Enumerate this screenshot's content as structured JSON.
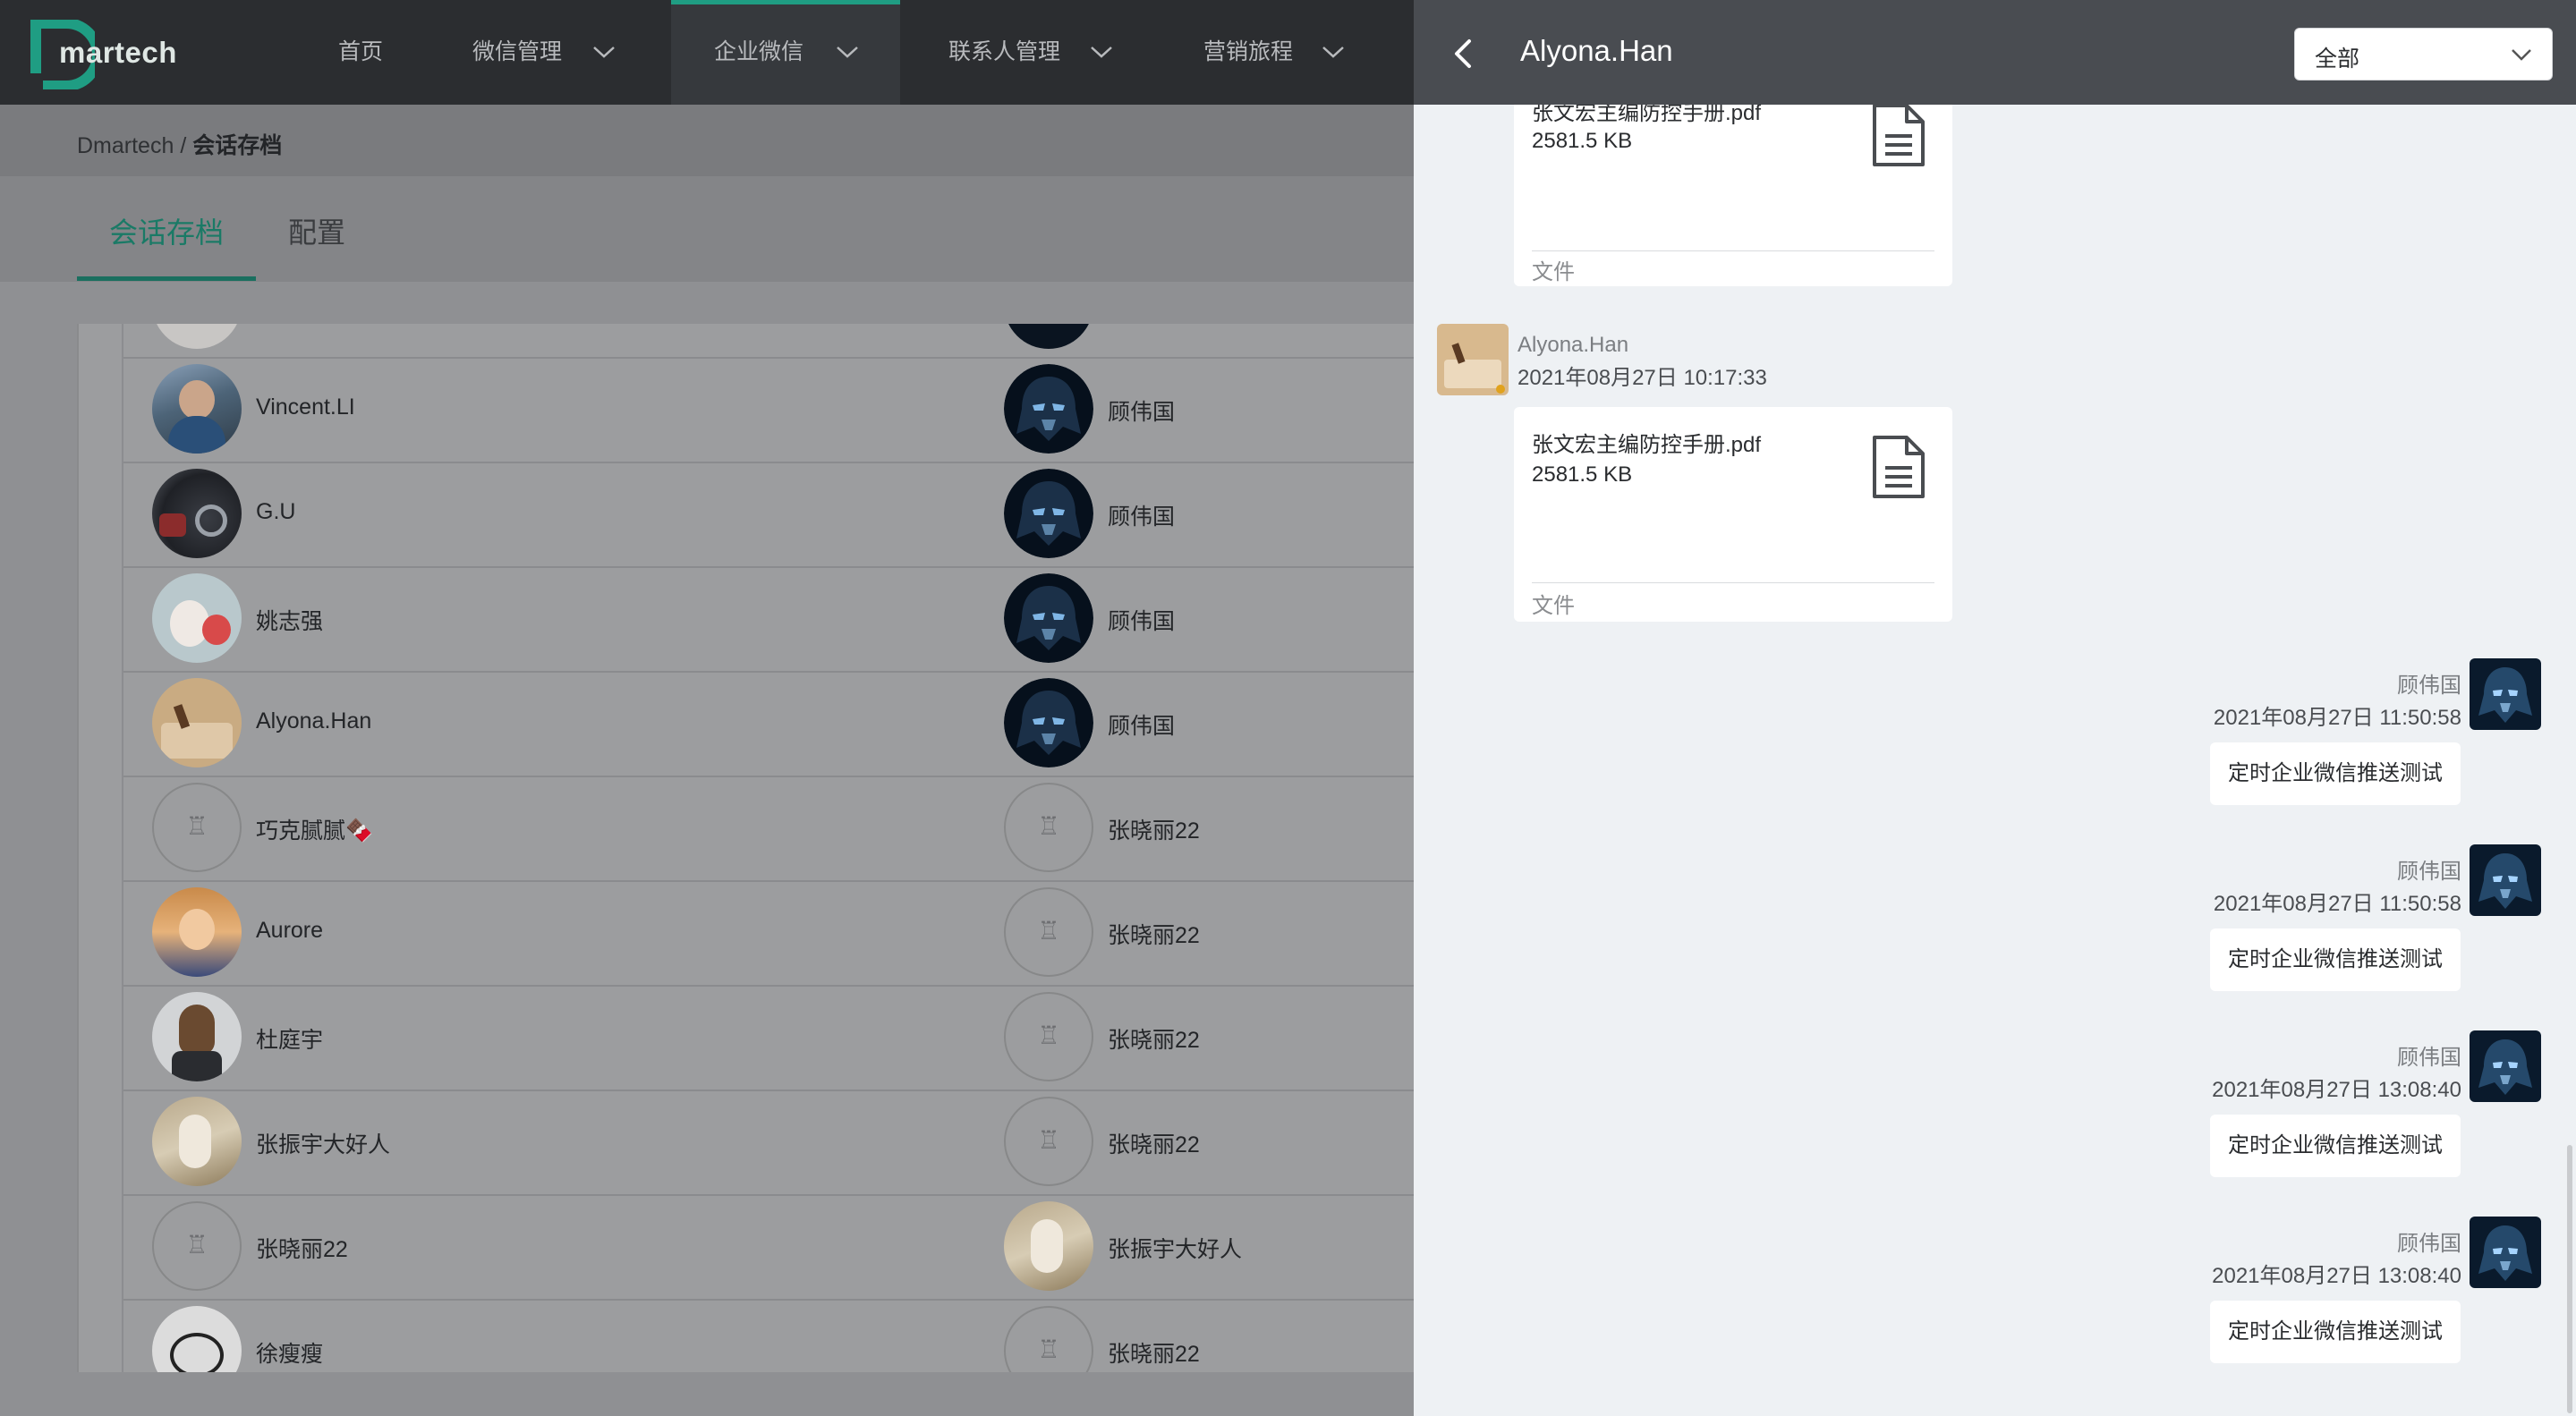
{
  "nav": {
    "logo_text": "martech",
    "items": [
      {
        "label": "首页"
      },
      {
        "label": "微信管理"
      },
      {
        "label": "企业微信"
      },
      {
        "label": "联系人管理"
      },
      {
        "label": "营销旅程"
      }
    ]
  },
  "breadcrumb": {
    "root": "Dmartech",
    "sep": " / ",
    "current": "会话存档"
  },
  "tabs": [
    {
      "label": "会话存档"
    },
    {
      "label": "配置"
    }
  ],
  "rows": [
    {
      "left": "",
      "right": ""
    },
    {
      "left": "Vincent.LI",
      "right": "顾伟国"
    },
    {
      "left": "G.U",
      "right": "顾伟国"
    },
    {
      "left": "姚志强",
      "right": "顾伟国"
    },
    {
      "left": "Alyona.Han",
      "right": "顾伟国"
    },
    {
      "left": "巧克腻腻🍫",
      "right": "张晓丽22"
    },
    {
      "left": "Aurore",
      "right": "张晓丽22"
    },
    {
      "left": "杜庭宇",
      "right": "张晓丽22"
    },
    {
      "left": "张振宇大好人",
      "right": "张晓丽22"
    },
    {
      "left": "张晓丽22",
      "right": "张振宇大好人"
    },
    {
      "left": "徐瘦瘦",
      "right": "张晓丽22"
    }
  ],
  "drawer": {
    "title": "Alyona.Han",
    "filter": {
      "value": "全部"
    },
    "messages": [
      {
        "file_name": "张文宏主编防控手册.pdf",
        "file_size": "2581.5 KB",
        "file_type": "文件"
      },
      {
        "sender": "Alyona.Han",
        "time": "2021年08月27日 10:17:33",
        "file_name": "张文宏主编防控手册.pdf",
        "file_size": "2581.5 KB",
        "file_type": "文件"
      },
      {
        "sender": "顾伟国",
        "time": "2021年08月27日 11:50:58",
        "text": "定时企业微信推送测试"
      },
      {
        "sender": "顾伟国",
        "time": "2021年08月27日 11:50:58",
        "text": "定时企业微信推送测试"
      },
      {
        "sender": "顾伟国",
        "time": "2021年08月27日 13:08:40",
        "text": "定时企业微信推送测试"
      },
      {
        "sender": "顾伟国",
        "time": "2021年08月27日 13:08:40",
        "text": "定时企业微信推送测试"
      }
    ]
  },
  "colors": {
    "accent": "#1f9d83",
    "nav_bg": "#2b2d30",
    "drawer_header": "#494c51",
    "drawer_bg": "#eef1f4"
  },
  "icons": [
    "logo-mark-icon",
    "chevron-down-icon",
    "back-arrow-icon",
    "document-icon",
    "avatar-placeholder-icon"
  ]
}
